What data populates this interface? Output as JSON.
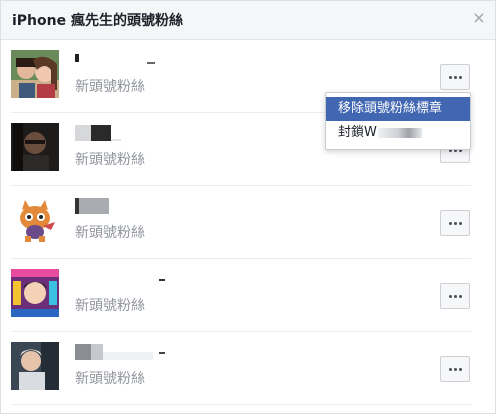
{
  "dialog": {
    "title": "iPhone 瘋先生的頭號粉絲",
    "close_icon": "close-icon"
  },
  "fans": [
    {
      "name": "",
      "subtitle": "新頭號粉絲",
      "avatar": "avatar-photo-couple"
    },
    {
      "name": "",
      "subtitle": "新頭號粉絲",
      "avatar": "avatar-photo-dark"
    },
    {
      "name": "",
      "subtitle": "新頭號粉絲",
      "avatar": "avatar-cartoon-cat"
    },
    {
      "name": "",
      "subtitle": "新頭號粉絲",
      "avatar": "avatar-anime-collage"
    },
    {
      "name": "",
      "subtitle": "新頭號粉絲",
      "avatar": "avatar-photo-man"
    }
  ],
  "more_button_icon": "more-horizontal-icon",
  "context_menu": {
    "items": [
      {
        "label": "移除頭號粉絲標章",
        "active": true
      },
      {
        "label": "封鎖W",
        "active": false
      }
    ]
  },
  "colors": {
    "menu_highlight": "#4267b2",
    "subtitle_text": "#90949c",
    "header_bg": "#f5f6f7"
  }
}
